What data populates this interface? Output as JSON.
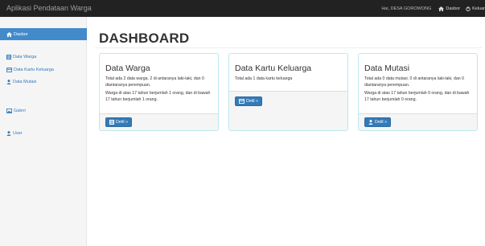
{
  "navbar": {
    "brand": "Aplikasi Pendataan Warga",
    "greeting": "Hai, DESA GOROWONG",
    "dashboard_link": "Dasbor",
    "logout_link": "Keluar"
  },
  "sidebar": {
    "items": [
      {
        "label": "Dasbor",
        "icon": "home-icon"
      },
      {
        "label": "Data Warga",
        "icon": "list-icon"
      },
      {
        "label": "Data Kartu Keluarga",
        "icon": "card-icon"
      },
      {
        "label": "Data Mutasi",
        "icon": "user-move-icon"
      },
      {
        "label": "Galeri",
        "icon": "image-icon"
      },
      {
        "label": "User",
        "icon": "user-icon"
      }
    ]
  },
  "main": {
    "title": "DASHBOARD",
    "cards": [
      {
        "title": "Data Warga",
        "line1": "Total ada 2 data warga. 2 di antaranya laki-laki, dan 0 diantaranya perempuan.",
        "line2": "Warga di atas 17 tahun berjumlah 1 orang, dan di bawah 17 tahun berjumlah 1 orang.",
        "button": "Detil »"
      },
      {
        "title": "Data Kartu Keluarga",
        "line1": "Total ada 1 data kartu keluarga",
        "button": "Detil »"
      },
      {
        "title": "Data Mutasi",
        "line1": "Total ada 0 data mutasi. 0 di antaranya laki-laki, dan 0 diantaranya perempuan.",
        "line2": "Warga di atas 17 tahun berjumlah 0 orang, dan di bawah 17 tahun berjumlah 0 orang.",
        "button": "Detil »"
      }
    ]
  },
  "colors": {
    "navbar_bg": "#222222",
    "accent": "#428bca",
    "button": "#337ab7",
    "card_border": "#bce8f1"
  }
}
